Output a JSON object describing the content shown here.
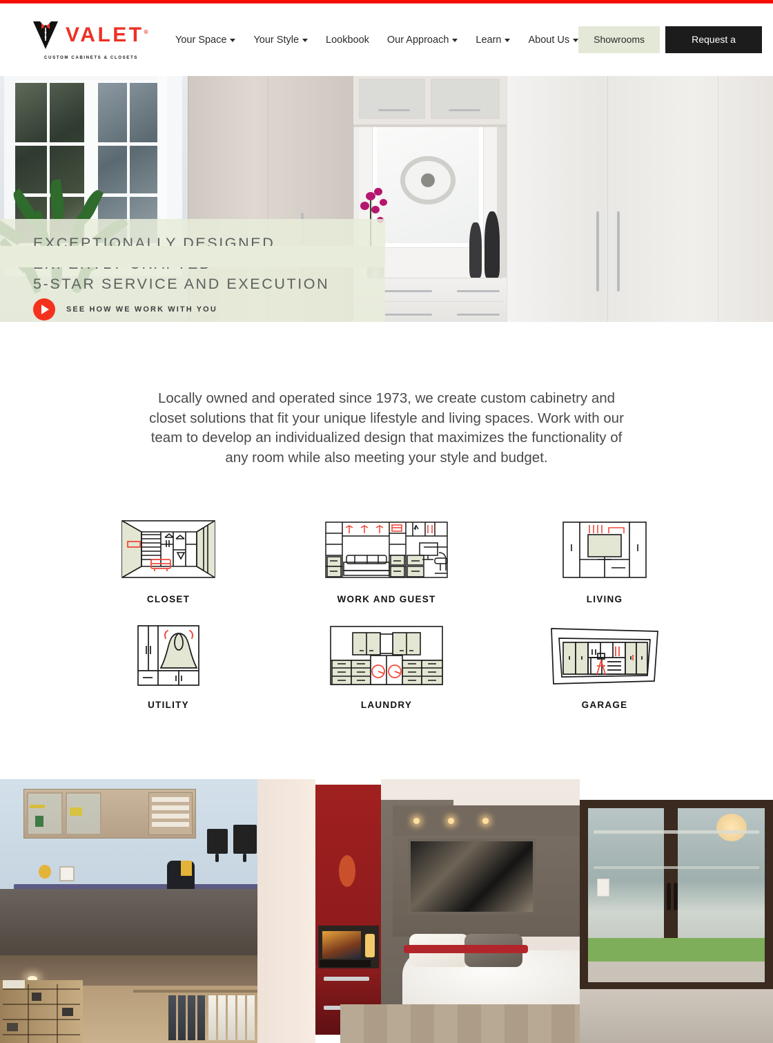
{
  "brand": {
    "name": "VALET",
    "trademark": "®",
    "tagline": "CUSTOM CABINETS & CLOSETS",
    "logo_icon": "valet-tuxedo-logo-icon",
    "accent_red": "#ed3124",
    "top_rule_color": "#f50d02",
    "sage": "#e4e8d6",
    "dark": "#1c1c1c"
  },
  "header": {
    "nav": [
      {
        "label": "Your Space",
        "has_dropdown": true
      },
      {
        "label": "Your Style",
        "has_dropdown": true
      },
      {
        "label": "Lookbook",
        "has_dropdown": false
      },
      {
        "label": "Our Approach",
        "has_dropdown": true
      },
      {
        "label": "Learn",
        "has_dropdown": true
      },
      {
        "label": "About Us",
        "has_dropdown": true
      }
    ],
    "showrooms_label": "Showrooms",
    "consultation_label": "Request a Consultation"
  },
  "hero": {
    "headline_line1": "EXCEPTIONALLY DESIGNED",
    "headline_line2": "EXPERTLY CRAFTED",
    "headline_line3": "5-STAR SERVICE AND EXECUTION",
    "cta_label": "SEE HOW WE WORK WITH YOU",
    "play_icon": "play-circle-icon",
    "image_alt": "White custom closet cabinetry with orchid, artwork and vases"
  },
  "intro": {
    "paragraph": "Locally owned and operated since 1973, we create custom cabinetry and closet solutions that fit your unique lifestyle and living spaces. Work with our team to develop an individualized design that maximizes the functionality of any room while also meeting your style and budget."
  },
  "categories": {
    "row1": [
      {
        "label": "CLOSET",
        "icon": "closet-room-icon"
      },
      {
        "label": "WORK AND GUEST",
        "icon": "work-and-guest-room-icon"
      },
      {
        "label": "LIVING",
        "icon": "living-room-media-wall-icon"
      }
    ],
    "row2": [
      {
        "label": "UTILITY",
        "icon": "utility-closet-icon"
      },
      {
        "label": "LAUNDRY",
        "icon": "laundry-room-icon"
      },
      {
        "label": "GARAGE",
        "icon": "garage-cabinets-icon"
      }
    ],
    "icon_colors": {
      "outline": "#1a1a1a",
      "fill": "#e2e6d2",
      "accent": "#f04b3c"
    }
  },
  "gallery": {
    "items": [
      {
        "name": "home-office",
        "alt": "Home office with built-in cabinetry and purple desk"
      },
      {
        "name": "walk-in-closet",
        "alt": "Walk-in closet with hanging clothes and shoe shelves"
      },
      {
        "name": "murphy-bed-room",
        "alt": "Guest room with red murphy bed wall unit and patio doors"
      }
    ]
  }
}
